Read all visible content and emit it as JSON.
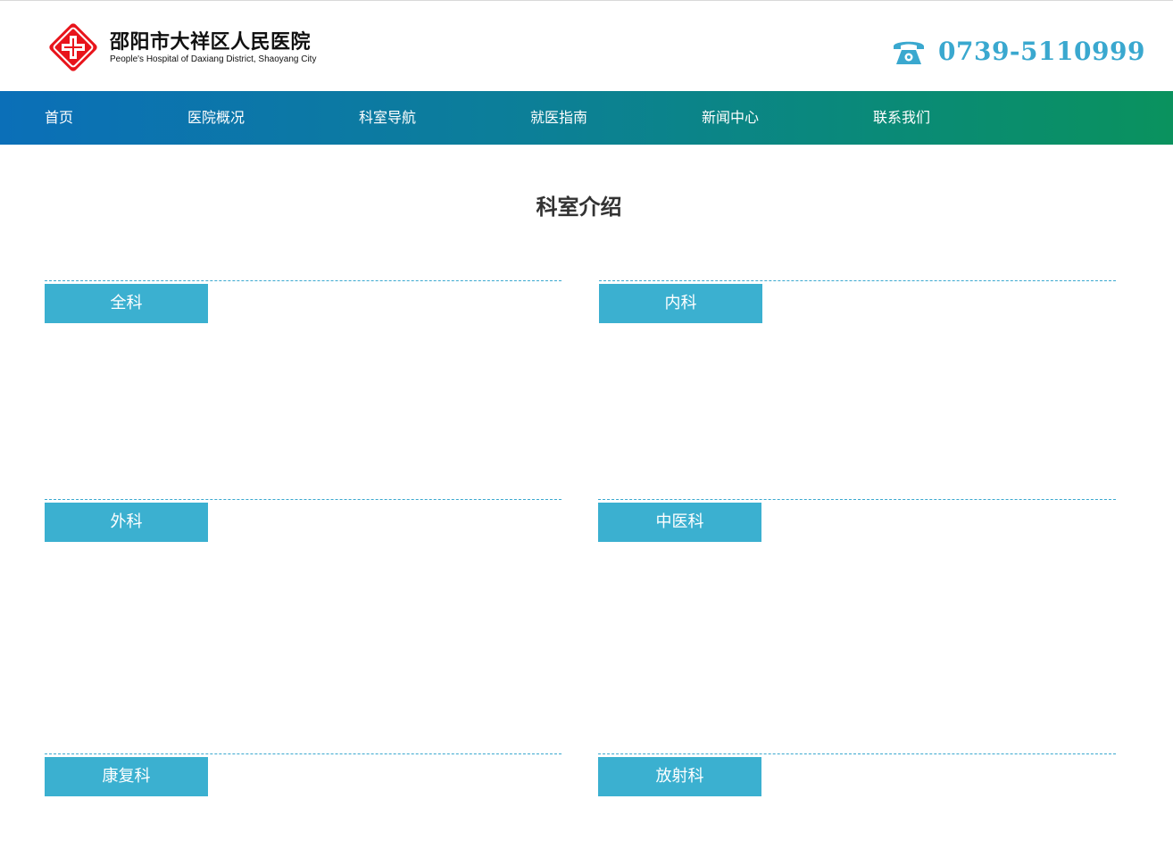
{
  "brand": {
    "name_cn": "邵阳市大祥区人民医院",
    "name_en": "People's Hospital of Daxiang District, Shaoyang City",
    "logo_icon": "red-cross-logo-icon"
  },
  "contact": {
    "phone_icon": "telephone-icon",
    "phone": "0739-5110999"
  },
  "nav": {
    "items": [
      {
        "label": "首页"
      },
      {
        "label": "医院概况"
      },
      {
        "label": "科室导航"
      },
      {
        "label": "就医指南"
      },
      {
        "label": "新闻中心"
      },
      {
        "label": "联系我们"
      }
    ]
  },
  "main": {
    "title": "科室介绍",
    "departments": [
      {
        "name": "全科"
      },
      {
        "name": "内科"
      },
      {
        "name": "外科"
      },
      {
        "name": "中医科"
      },
      {
        "name": "康复科"
      },
      {
        "name": "放射科"
      }
    ]
  },
  "colors": {
    "accent": "#3aa8cf",
    "tag_bg": "#3bb0d0",
    "nav_start": "#0b6fb8",
    "nav_end": "#0a925e",
    "logo_red": "#e8141b"
  }
}
